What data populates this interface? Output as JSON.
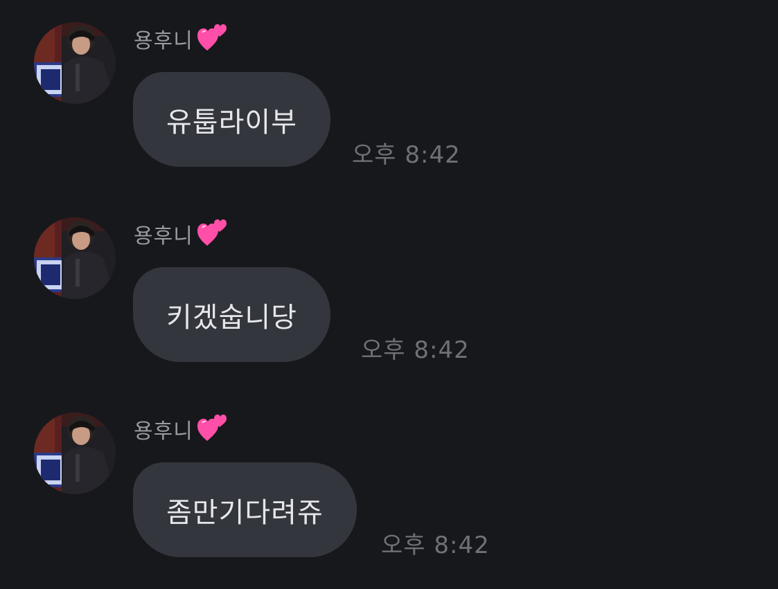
{
  "chat": {
    "messages": [
      {
        "sender": "용후니",
        "sender_emoji": "two-hearts-icon",
        "text": "유툽라이부",
        "time": "오후 8:42"
      },
      {
        "sender": "용후니",
        "sender_emoji": "two-hearts-icon",
        "text": "키겠숩니당",
        "time": "오후 8:42"
      },
      {
        "sender": "용후니",
        "sender_emoji": "two-hearts-icon",
        "text": "좀만기다려쥬",
        "time": "오후 8:42"
      }
    ]
  },
  "colors": {
    "background": "#17181c",
    "bubble": "#34363d",
    "bubble_text": "#e6e7ea",
    "sender_text": "#9a9ca3",
    "time_text": "#6f7178",
    "heart_pink": "#ff4fa8"
  }
}
